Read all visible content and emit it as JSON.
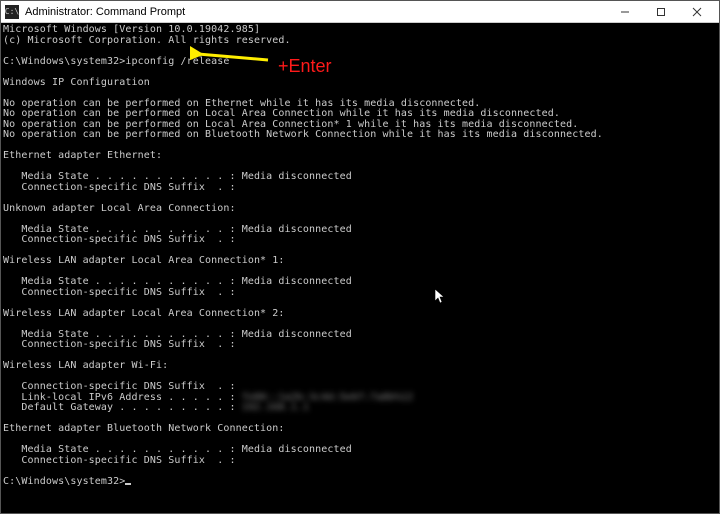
{
  "window": {
    "title": "Administrator: Command Prompt",
    "icon_label": "C:\\"
  },
  "annotation": {
    "enter": "+Enter"
  },
  "term": {
    "version_line": "Microsoft Windows [Version 10.0.19042.985]",
    "copyright_line": "(c) Microsoft Corporation. All rights reserved.",
    "prompt1_path": "C:\\Windows\\system32>",
    "prompt1_cmd": "ipconfig /release",
    "hdr_ipconfig": "Windows IP Configuration",
    "noop_eth": "No operation can be performed on Ethernet while it has its media disconnected.",
    "noop_lac": "No operation can be performed on Local Area Connection while it has its media disconnected.",
    "noop_lac1": "No operation can be performed on Local Area Connection* 1 while it has its media disconnected.",
    "noop_bt": "No operation can be performed on Bluetooth Network Connection while it has its media disconnected.",
    "adapter_eth": "Ethernet adapter Ethernet:",
    "media_state": "   Media State . . . . . . . . . . . : Media disconnected",
    "dns_suffix": "   Connection-specific DNS Suffix  . :",
    "adapter_unk_lac": "Unknown adapter Local Area Connection:",
    "adapter_wlan_lac1": "Wireless LAN adapter Local Area Connection* 1:",
    "adapter_wlan_lac2": "Wireless LAN adapter Local Area Connection* 2:",
    "adapter_wifi": "Wireless LAN adapter Wi-Fi:",
    "wifi_ipv6": "   Link-local IPv6 Address . . . . . : ",
    "wifi_gateway": "   Default Gateway . . . . . . . . . : ",
    "wifi_ipv6_val": "fe80::1a2b:3c4d:5e6f:7a8b%12",
    "wifi_gateway_val": "192.168.1.1",
    "adapter_bt": "Ethernet adapter Bluetooth Network Connection:",
    "prompt2_path": "C:\\Windows\\system32>"
  }
}
